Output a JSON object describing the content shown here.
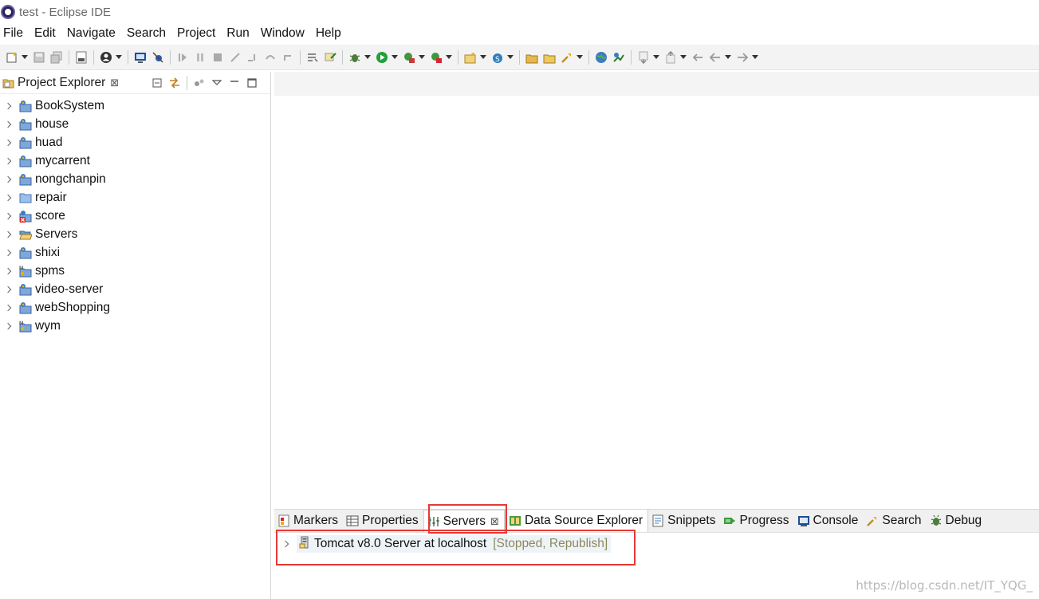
{
  "window": {
    "title": "test - Eclipse IDE"
  },
  "menu": [
    "File",
    "Edit",
    "Navigate",
    "Search",
    "Project",
    "Run",
    "Window",
    "Help"
  ],
  "project_explorer": {
    "title": "Project Explorer",
    "close_glyph": "⊠",
    "projects": [
      {
        "label": "BookSystem",
        "icon": "web-project-icon"
      },
      {
        "label": "house",
        "icon": "web-project-icon"
      },
      {
        "label": "huad",
        "icon": "web-project-icon"
      },
      {
        "label": "mycarrent",
        "icon": "web-project-icon"
      },
      {
        "label": "nongchanpin",
        "icon": "web-project-icon"
      },
      {
        "label": "repair",
        "icon": "folder-icon"
      },
      {
        "label": "score",
        "icon": "web-project-error-icon"
      },
      {
        "label": "Servers",
        "icon": "open-folder-icon"
      },
      {
        "label": "shixi",
        "icon": "web-project-icon"
      },
      {
        "label": "spms",
        "icon": "maven-project-icon"
      },
      {
        "label": "video-server",
        "icon": "web-project-icon"
      },
      {
        "label": "webShopping",
        "icon": "web-project-icon"
      },
      {
        "label": "wym",
        "icon": "maven-project-icon"
      }
    ]
  },
  "bottom_panel": {
    "tabs": [
      {
        "label": "Markers",
        "icon": "markers-icon"
      },
      {
        "label": "Properties",
        "icon": "properties-icon"
      },
      {
        "label": "Servers",
        "icon": "servers-icon",
        "active": true
      },
      {
        "label": "Data Source Explorer",
        "icon": "data-source-icon"
      },
      {
        "label": "Snippets",
        "icon": "snippets-icon"
      },
      {
        "label": "Progress",
        "icon": "progress-icon"
      },
      {
        "label": "Console",
        "icon": "console-icon"
      },
      {
        "label": "Search",
        "icon": "search-icon"
      },
      {
        "label": "Debug",
        "icon": "debug-icon"
      }
    ],
    "active_close_glyph": "⊠",
    "server": {
      "label": "Tomcat v8.0 Server at localhost",
      "status": "[Stopped, Republish]"
    }
  },
  "watermark": "https://blog.csdn.net/IT_YQG_",
  "colors": {
    "highlight": "#e53935",
    "toolbar_bg": "#f3f3f3",
    "tab_bar_bg": "#f0f0f0",
    "status_text": "#8a8a5a"
  }
}
